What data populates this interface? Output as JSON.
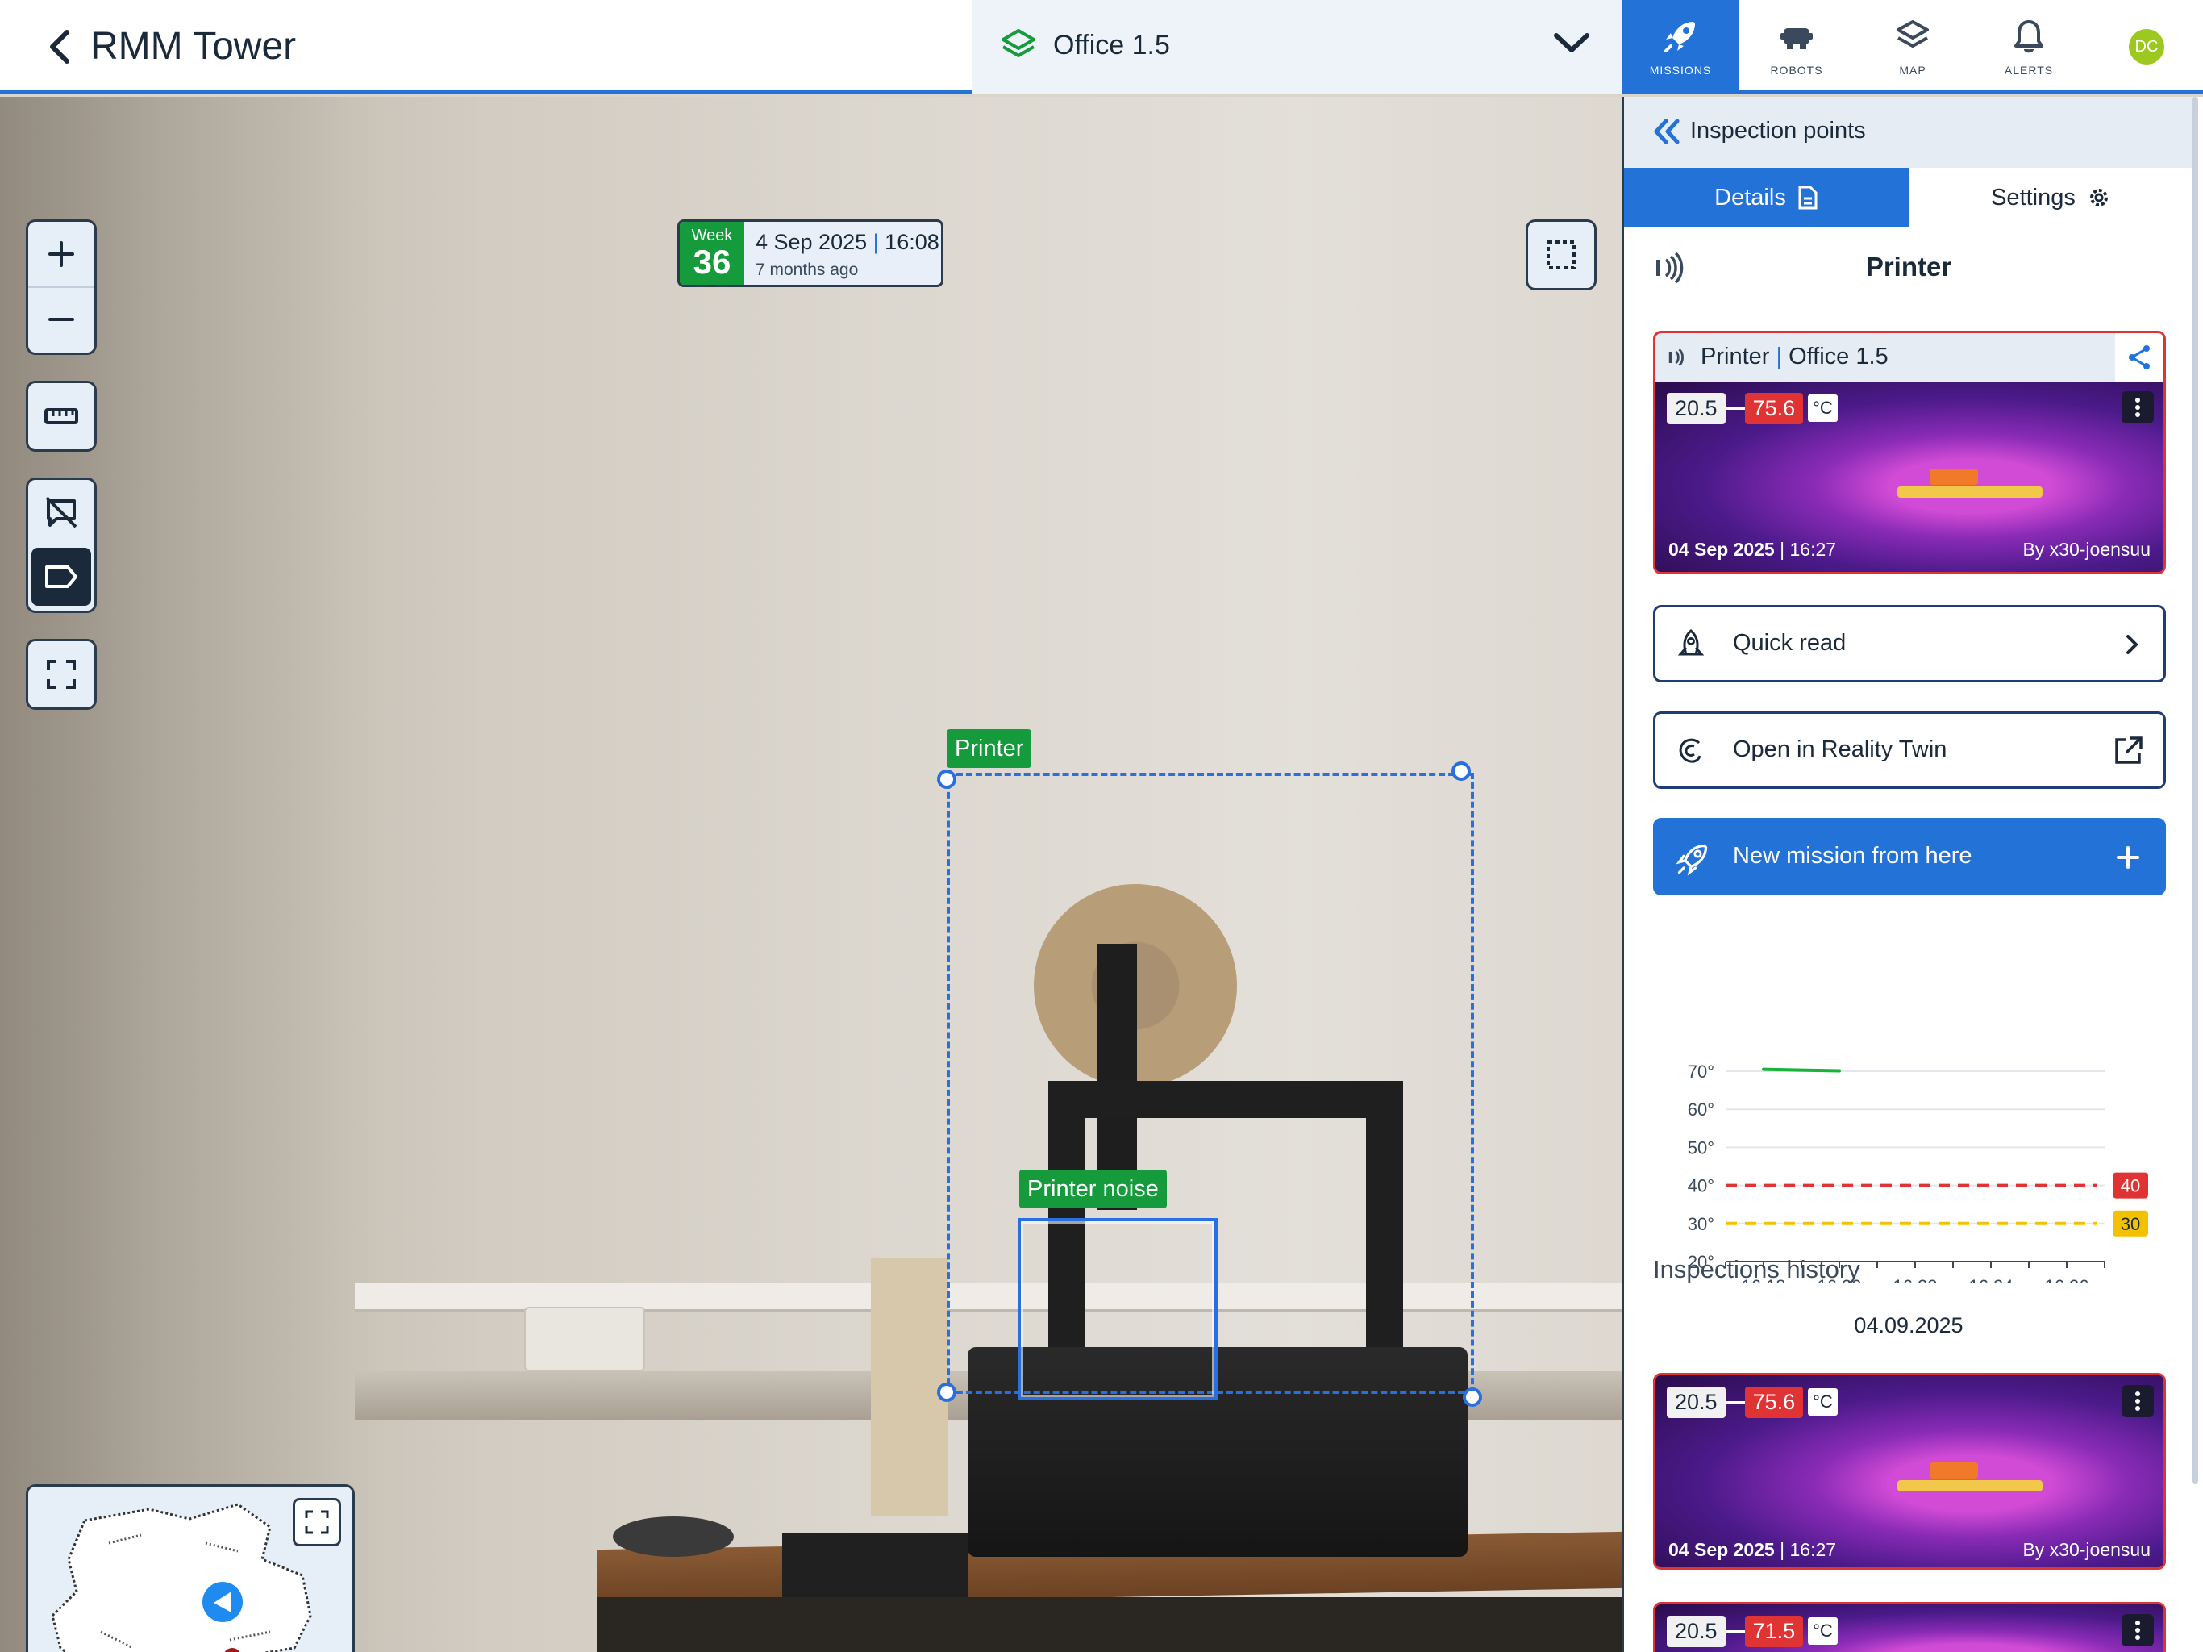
{
  "header": {
    "site_title": "RMM Tower",
    "floor": "Office 1.5",
    "tabs": [
      {
        "label": "MISSIONS",
        "icon": "rocket-icon",
        "active": true
      },
      {
        "label": "ROBOTS",
        "icon": "robot-icon",
        "active": false
      },
      {
        "label": "MAP",
        "icon": "layers-icon",
        "active": false
      },
      {
        "label": "ALERTS",
        "icon": "bell-icon",
        "active": false
      }
    ],
    "avatar_initials": "DC"
  },
  "viewer": {
    "week_label": "Week",
    "week_number": "36",
    "date": "4 Sep 2025",
    "time": "16:08",
    "ago": "7 months ago",
    "annotations": [
      {
        "label": "Printer"
      },
      {
        "label": "Printer noise"
      }
    ]
  },
  "panel": {
    "header_title": "Inspection points",
    "tab_details": "Details",
    "tab_settings": "Settings",
    "point_title": "Printer",
    "card": {
      "name": "Printer",
      "location": "Office 1.5",
      "low": "20.5",
      "high": "75.6",
      "unit": "°C",
      "date": "04 Sep 2025",
      "time": "16:27",
      "by": "By x30-joensuu"
    },
    "actions": {
      "quick_read": "Quick read",
      "reality_twin": "Open in Reality Twin",
      "new_mission": "New mission from here"
    },
    "history_title": "Inspections history",
    "history_date": "04.09.2025",
    "history": [
      {
        "low": "20.5",
        "high": "75.6",
        "unit": "°C",
        "date": "04 Sep 2025",
        "time": "16:27",
        "by": "By x30-joensuu"
      },
      {
        "low": "20.5",
        "high": "71.5",
        "unit": "°C"
      }
    ]
  },
  "chart_data": {
    "type": "line",
    "x": [
      "16:18",
      "16:20",
      "16:22",
      "16:24",
      "16:26"
    ],
    "y_ticks": [
      "70°",
      "60°",
      "50°",
      "40°",
      "30°",
      "20°"
    ],
    "ylim": [
      20,
      70
    ],
    "series": [
      {
        "values": [
          70.5,
          70.3,
          70.1
        ],
        "x_times": [
          "16:18",
          "16:19",
          "16:20"
        ],
        "color": "#18b33a"
      }
    ],
    "thresholds": [
      {
        "value": 40,
        "label": "40",
        "color": "#e03434"
      },
      {
        "value": 30,
        "label": "30",
        "color": "#f2c200"
      }
    ]
  }
}
